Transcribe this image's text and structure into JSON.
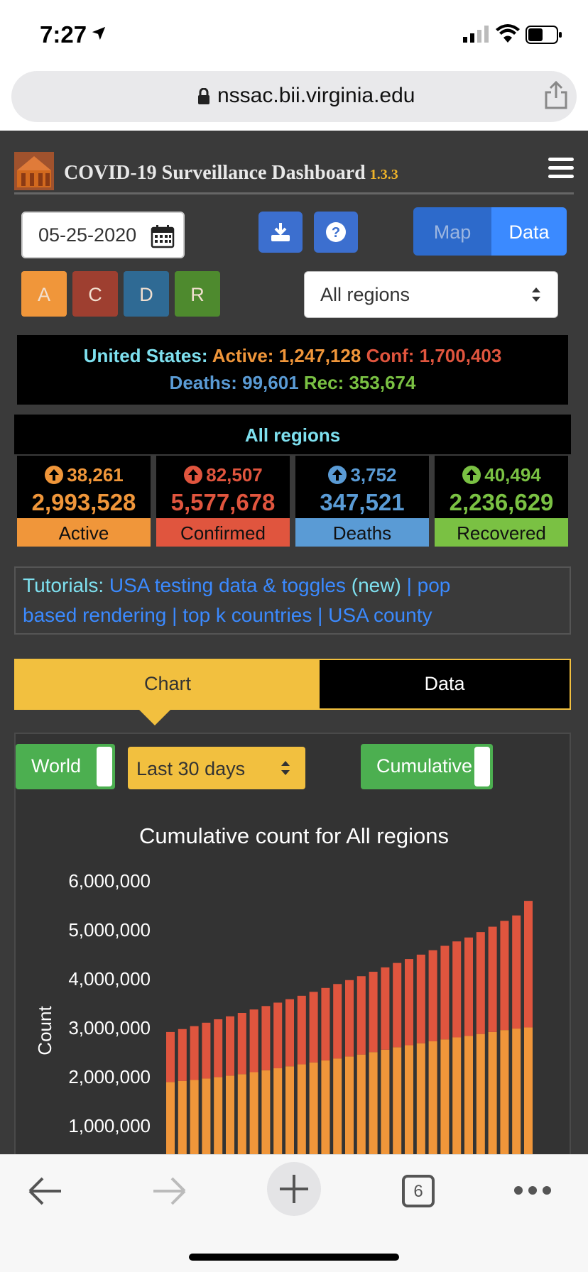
{
  "status_bar": {
    "time": "7:27"
  },
  "browser": {
    "url": "nssac.bii.virginia.edu",
    "tab_count": "6"
  },
  "header": {
    "title": "COVID-19 Surveillance Dashboard",
    "version": "1.3.3"
  },
  "controls": {
    "date": "05-25-2020",
    "map_label": "Map",
    "data_label": "Data",
    "type_buttons": [
      "A",
      "C",
      "D",
      "R"
    ],
    "region_select": "All regions"
  },
  "us_summary": {
    "country": "United States:",
    "active": "Active: 1,247,128",
    "conf": "Conf: 1,700,403",
    "deaths": "Deaths: 99,601",
    "rec": "Rec: 353,674"
  },
  "region": {
    "title": "All regions",
    "stats": [
      {
        "increase": "38,261",
        "total": "2,993,528",
        "label": "Active",
        "color": "#f0963a"
      },
      {
        "increase": "82,507",
        "total": "5,577,678",
        "label": "Confirmed",
        "color": "#e0553e"
      },
      {
        "increase": "3,752",
        "total": "347,521",
        "label": "Deaths",
        "color": "#5a9bd5"
      },
      {
        "increase": "40,494",
        "total": "2,236,629",
        "label": "Recovered",
        "color": "#7ac143"
      }
    ]
  },
  "tutorials": {
    "prefix": "Tutorials:",
    "link1": "USA testing data & toggles",
    "new_tag": "(new)",
    "sep": "|",
    "link2a": "pop",
    "link2b": "based rendering",
    "link3": "top k countries",
    "link4": "USA county"
  },
  "tabs": {
    "chart": "Chart",
    "data": "Data"
  },
  "chart_controls": {
    "world": "World",
    "range": "Last 30 days",
    "mode": "Cumulative"
  },
  "chart_data": {
    "type": "bar",
    "title": "Cumulative count for All regions",
    "ylabel": "Count",
    "ylim": [
      0,
      6000000
    ],
    "yticks": [
      "1,000,000",
      "2,000,000",
      "3,000,000",
      "4,000,000",
      "5,000,000",
      "6,000,000"
    ],
    "stacked": true,
    "series": [
      {
        "name": "Active",
        "color": "#f0963a",
        "values": [
          1880000,
          1900000,
          1920000,
          1950000,
          1980000,
          2010000,
          2040000,
          2080000,
          2120000,
          2160000,
          2200000,
          2240000,
          2280000,
          2320000,
          2360000,
          2400000,
          2440000,
          2490000,
          2540000,
          2590000,
          2630000,
          2670000,
          2710000,
          2750000,
          2790000,
          2820000,
          2860000,
          2900000,
          2940000,
          2970000,
          2993528
        ]
      },
      {
        "name": "Confirmed",
        "color": "#e0553e",
        "values": [
          1020000,
          1060000,
          1100000,
          1140000,
          1180000,
          1210000,
          1250000,
          1280000,
          1310000,
          1340000,
          1370000,
          1400000,
          1440000,
          1480000,
          1520000,
          1560000,
          1600000,
          1640000,
          1680000,
          1720000,
          1760000,
          1810000,
          1860000,
          1910000,
          1960000,
          2010000,
          2080000,
          2150000,
          2230000,
          2310000,
          2584150
        ]
      }
    ]
  },
  "colors": {
    "accent_yellow": "#f2c03f",
    "primary_blue": "#3b8aff",
    "toggle_green": "#4caf50"
  },
  "icons": [
    "location-arrow-icon",
    "signal-icon",
    "wifi-icon",
    "battery-icon",
    "lock-icon",
    "share-icon",
    "calendar-icon",
    "download-icon",
    "help-icon",
    "info-icon",
    "back-icon",
    "forward-icon",
    "new-tab-icon",
    "tabs-icon",
    "more-icon"
  ]
}
